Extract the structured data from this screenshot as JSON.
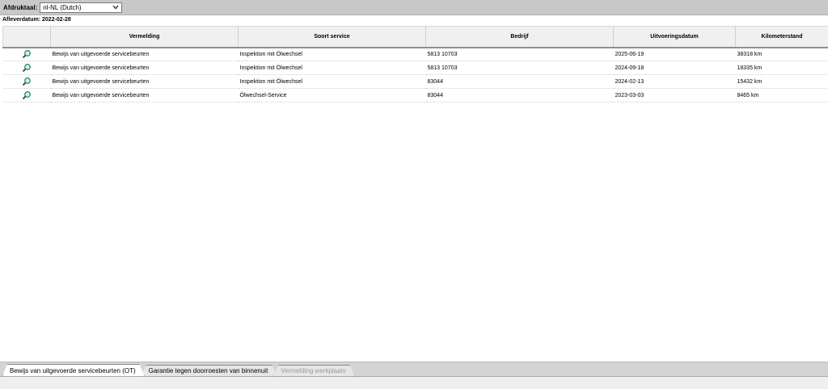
{
  "topbar": {
    "label": "Afdruktaal:",
    "language_value": "nl-NL (Dutch)"
  },
  "delivery_date": "Afleverdatum: 2022-02-28",
  "table": {
    "headers": [
      "",
      "Vermelding",
      "Soort service",
      "Bedrijf",
      "Uitvoeringsdatum",
      "Kilometerstand"
    ],
    "rows": [
      {
        "vermelding": "Bewijs van uitgevoerde servicebeurten",
        "soort": "Inspektion mit Ölwechsel",
        "bedrijf": "5813 10703",
        "datum": "2025-06-19",
        "km": "38318 km"
      },
      {
        "vermelding": "Bewijs van uitgevoerde servicebeurten",
        "soort": "Inspektion mit Ölwechsel",
        "bedrijf": "5813 10703",
        "datum": "2024-09-18",
        "km": "18335 km"
      },
      {
        "vermelding": "Bewijs van uitgevoerde servicebeurten",
        "soort": "Inspektion mit Ölwechsel",
        "bedrijf": "83044",
        "datum": "2024-02-13",
        "km": "15432 km"
      },
      {
        "vermelding": "Bewijs van uitgevoerde servicebeurten",
        "soort": "Ölwechsel-Service",
        "bedrijf": "83044",
        "datum": "2023-03-03",
        "km": "8465 km"
      }
    ]
  },
  "tabs": [
    {
      "label": "Bewijs van uitgevoerde servicebeurten (OT)"
    },
    {
      "label": "Garantie tegen doorroesten van binnenuit"
    },
    {
      "label": "Vermelding werkplaats"
    }
  ],
  "icons": {
    "row_view": "magnifier-icon",
    "dropdown": "chevron-down-icon"
  }
}
